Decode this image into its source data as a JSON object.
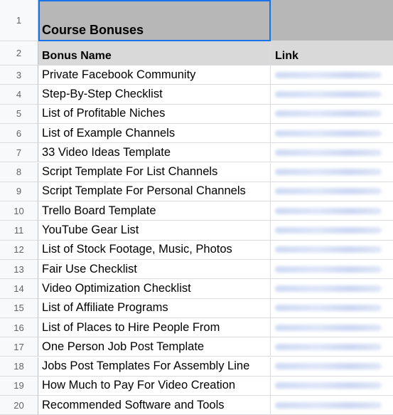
{
  "sheet": {
    "title_row": {
      "num": "1",
      "title": "Course Bonuses"
    },
    "header_row": {
      "num": "2",
      "col_a": "Bonus Name",
      "col_b": "Link"
    },
    "rows": [
      {
        "num": "3",
        "name": "Private Facebook Community"
      },
      {
        "num": "4",
        "name": "Step-By-Step Checklist"
      },
      {
        "num": "5",
        "name": "List of Profitable Niches"
      },
      {
        "num": "6",
        "name": "List of Example Channels"
      },
      {
        "num": "7",
        "name": "33 Video Ideas Template"
      },
      {
        "num": "8",
        "name": "Script Template For List Channels"
      },
      {
        "num": "9",
        "name": "Script Template For Personal Channels"
      },
      {
        "num": "10",
        "name": "Trello Board Template"
      },
      {
        "num": "11",
        "name": "YouTube Gear List"
      },
      {
        "num": "12",
        "name": "List of Stock Footage, Music, Photos"
      },
      {
        "num": "13",
        "name": "Fair Use Checklist"
      },
      {
        "num": "14",
        "name": "Video Optimization Checklist"
      },
      {
        "num": "15",
        "name": "List of Affiliate Programs"
      },
      {
        "num": "16",
        "name": "List of Places to Hire People From"
      },
      {
        "num": "17",
        "name": "One Person Job Post Template"
      },
      {
        "num": "18",
        "name": "Jobs Post Templates For Assembly Line"
      },
      {
        "num": "19",
        "name": "How Much to Pay For Video Creation"
      },
      {
        "num": "20",
        "name": "Recommended Software and Tools"
      }
    ]
  },
  "colors": {
    "selection": "#1a73e8",
    "title_fill": "#b7b7b7",
    "header_fill": "#d9d9d9"
  }
}
